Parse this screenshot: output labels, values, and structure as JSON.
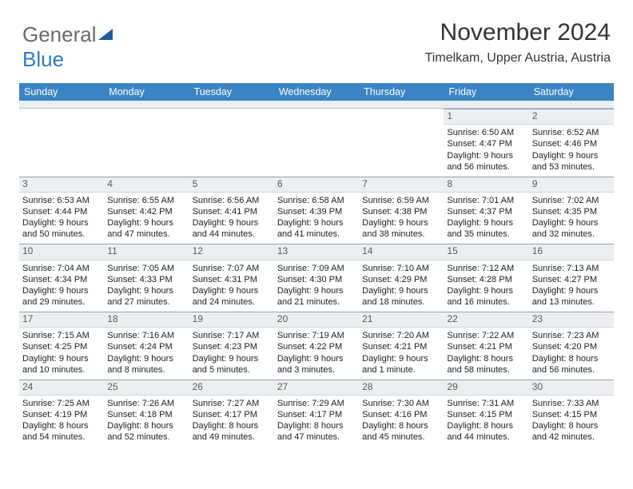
{
  "brand": {
    "part1": "General",
    "part2": "Blue"
  },
  "title": {
    "month": "November 2024",
    "location": "Timelkam, Upper Austria, Austria"
  },
  "day_headers": [
    "Sunday",
    "Monday",
    "Tuesday",
    "Wednesday",
    "Thursday",
    "Friday",
    "Saturday"
  ],
  "weeks": [
    [
      {
        "n": "",
        "sr": "",
        "ss": "",
        "dl": ""
      },
      {
        "n": "",
        "sr": "",
        "ss": "",
        "dl": ""
      },
      {
        "n": "",
        "sr": "",
        "ss": "",
        "dl": ""
      },
      {
        "n": "",
        "sr": "",
        "ss": "",
        "dl": ""
      },
      {
        "n": "",
        "sr": "",
        "ss": "",
        "dl": ""
      },
      {
        "n": "1",
        "sr": "Sunrise: 6:50 AM",
        "ss": "Sunset: 4:47 PM",
        "dl": "Daylight: 9 hours and 56 minutes."
      },
      {
        "n": "2",
        "sr": "Sunrise: 6:52 AM",
        "ss": "Sunset: 4:46 PM",
        "dl": "Daylight: 9 hours and 53 minutes."
      }
    ],
    [
      {
        "n": "3",
        "sr": "Sunrise: 6:53 AM",
        "ss": "Sunset: 4:44 PM",
        "dl": "Daylight: 9 hours and 50 minutes."
      },
      {
        "n": "4",
        "sr": "Sunrise: 6:55 AM",
        "ss": "Sunset: 4:42 PM",
        "dl": "Daylight: 9 hours and 47 minutes."
      },
      {
        "n": "5",
        "sr": "Sunrise: 6:56 AM",
        "ss": "Sunset: 4:41 PM",
        "dl": "Daylight: 9 hours and 44 minutes."
      },
      {
        "n": "6",
        "sr": "Sunrise: 6:58 AM",
        "ss": "Sunset: 4:39 PM",
        "dl": "Daylight: 9 hours and 41 minutes."
      },
      {
        "n": "7",
        "sr": "Sunrise: 6:59 AM",
        "ss": "Sunset: 4:38 PM",
        "dl": "Daylight: 9 hours and 38 minutes."
      },
      {
        "n": "8",
        "sr": "Sunrise: 7:01 AM",
        "ss": "Sunset: 4:37 PM",
        "dl": "Daylight: 9 hours and 35 minutes."
      },
      {
        "n": "9",
        "sr": "Sunrise: 7:02 AM",
        "ss": "Sunset: 4:35 PM",
        "dl": "Daylight: 9 hours and 32 minutes."
      }
    ],
    [
      {
        "n": "10",
        "sr": "Sunrise: 7:04 AM",
        "ss": "Sunset: 4:34 PM",
        "dl": "Daylight: 9 hours and 29 minutes."
      },
      {
        "n": "11",
        "sr": "Sunrise: 7:05 AM",
        "ss": "Sunset: 4:33 PM",
        "dl": "Daylight: 9 hours and 27 minutes."
      },
      {
        "n": "12",
        "sr": "Sunrise: 7:07 AM",
        "ss": "Sunset: 4:31 PM",
        "dl": "Daylight: 9 hours and 24 minutes."
      },
      {
        "n": "13",
        "sr": "Sunrise: 7:09 AM",
        "ss": "Sunset: 4:30 PM",
        "dl": "Daylight: 9 hours and 21 minutes."
      },
      {
        "n": "14",
        "sr": "Sunrise: 7:10 AM",
        "ss": "Sunset: 4:29 PM",
        "dl": "Daylight: 9 hours and 18 minutes."
      },
      {
        "n": "15",
        "sr": "Sunrise: 7:12 AM",
        "ss": "Sunset: 4:28 PM",
        "dl": "Daylight: 9 hours and 16 minutes."
      },
      {
        "n": "16",
        "sr": "Sunrise: 7:13 AM",
        "ss": "Sunset: 4:27 PM",
        "dl": "Daylight: 9 hours and 13 minutes."
      }
    ],
    [
      {
        "n": "17",
        "sr": "Sunrise: 7:15 AM",
        "ss": "Sunset: 4:25 PM",
        "dl": "Daylight: 9 hours and 10 minutes."
      },
      {
        "n": "18",
        "sr": "Sunrise: 7:16 AM",
        "ss": "Sunset: 4:24 PM",
        "dl": "Daylight: 9 hours and 8 minutes."
      },
      {
        "n": "19",
        "sr": "Sunrise: 7:17 AM",
        "ss": "Sunset: 4:23 PM",
        "dl": "Daylight: 9 hours and 5 minutes."
      },
      {
        "n": "20",
        "sr": "Sunrise: 7:19 AM",
        "ss": "Sunset: 4:22 PM",
        "dl": "Daylight: 9 hours and 3 minutes."
      },
      {
        "n": "21",
        "sr": "Sunrise: 7:20 AM",
        "ss": "Sunset: 4:21 PM",
        "dl": "Daylight: 9 hours and 1 minute."
      },
      {
        "n": "22",
        "sr": "Sunrise: 7:22 AM",
        "ss": "Sunset: 4:21 PM",
        "dl": "Daylight: 8 hours and 58 minutes."
      },
      {
        "n": "23",
        "sr": "Sunrise: 7:23 AM",
        "ss": "Sunset: 4:20 PM",
        "dl": "Daylight: 8 hours and 56 minutes."
      }
    ],
    [
      {
        "n": "24",
        "sr": "Sunrise: 7:25 AM",
        "ss": "Sunset: 4:19 PM",
        "dl": "Daylight: 8 hours and 54 minutes."
      },
      {
        "n": "25",
        "sr": "Sunrise: 7:26 AM",
        "ss": "Sunset: 4:18 PM",
        "dl": "Daylight: 8 hours and 52 minutes."
      },
      {
        "n": "26",
        "sr": "Sunrise: 7:27 AM",
        "ss": "Sunset: 4:17 PM",
        "dl": "Daylight: 8 hours and 49 minutes."
      },
      {
        "n": "27",
        "sr": "Sunrise: 7:29 AM",
        "ss": "Sunset: 4:17 PM",
        "dl": "Daylight: 8 hours and 47 minutes."
      },
      {
        "n": "28",
        "sr": "Sunrise: 7:30 AM",
        "ss": "Sunset: 4:16 PM",
        "dl": "Daylight: 8 hours and 45 minutes."
      },
      {
        "n": "29",
        "sr": "Sunrise: 7:31 AM",
        "ss": "Sunset: 4:15 PM",
        "dl": "Daylight: 8 hours and 44 minutes."
      },
      {
        "n": "30",
        "sr": "Sunrise: 7:33 AM",
        "ss": "Sunset: 4:15 PM",
        "dl": "Daylight: 8 hours and 42 minutes."
      }
    ]
  ]
}
